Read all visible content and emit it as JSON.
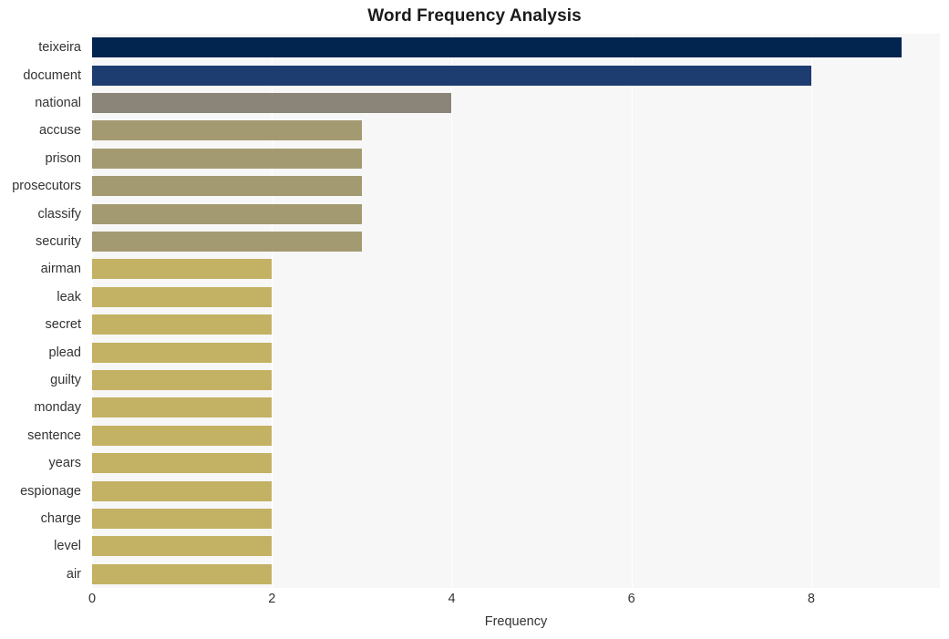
{
  "chart_data": {
    "type": "bar",
    "orientation": "horizontal",
    "title": "Word Frequency Analysis",
    "xlabel": "Frequency",
    "ylabel": "",
    "xlim": [
      0,
      9.43
    ],
    "xticks": [
      0,
      2,
      4,
      6,
      8
    ],
    "xtick_labels": [
      "0",
      "2",
      "4",
      "6",
      "8"
    ],
    "grid": "vertical",
    "legend": "none",
    "categories": [
      "teixeira",
      "document",
      "national",
      "accuse",
      "prison",
      "prosecutors",
      "classify",
      "security",
      "airman",
      "leak",
      "secret",
      "plead",
      "guilty",
      "monday",
      "sentence",
      "years",
      "espionage",
      "charge",
      "level",
      "air"
    ],
    "values": [
      9,
      8,
      4,
      3,
      3,
      3,
      3,
      3,
      2,
      2,
      2,
      2,
      2,
      2,
      2,
      2,
      2,
      2,
      2,
      2
    ],
    "bar_colors": [
      "#02254f",
      "#1d3c70",
      "#8a8578",
      "#a49a71",
      "#a49a71",
      "#a49a71",
      "#a49a71",
      "#a49a71",
      "#c3b164",
      "#c3b164",
      "#c3b164",
      "#c3b164",
      "#c3b164",
      "#c3b164",
      "#c3b164",
      "#c3b164",
      "#c3b164",
      "#c3b164",
      "#c3b164",
      "#c3b164"
    ],
    "plot_background": "#f7f7f7",
    "gridline_color": "#ffffff",
    "figure_background": "#ffffff",
    "text_color": "#333333",
    "title_color": "#1a1a1a"
  }
}
